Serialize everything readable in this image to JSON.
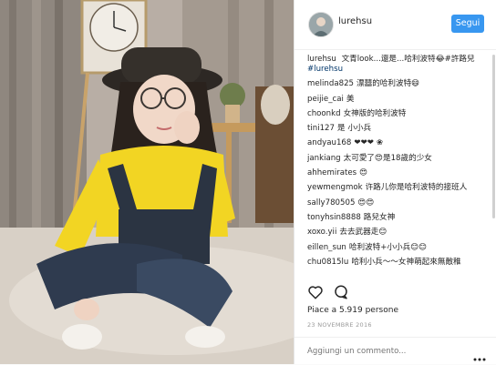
{
  "post": {
    "username": "lurehsu",
    "follow_label": "Segui",
    "likes_text": "Piace a 5.919 persone",
    "date_text": "23 NOVEMBRE 2016",
    "comment_placeholder": "Aggiungi un commento..."
  },
  "caption": {
    "user": "lurehsu",
    "text": "文青look...還是...哈利波特😂#許路兒",
    "tag": "#lurehsu"
  },
  "comments": [
    {
      "user": "melinda825",
      "text": "漂囍的哈利波特😄"
    },
    {
      "user": "peijie_cai",
      "text": "美"
    },
    {
      "user": "choonkd",
      "text": "女神版的哈利波特"
    },
    {
      "user": "tini127",
      "text": "是 小小兵"
    },
    {
      "user": "andyau168",
      "text": "❤❤❤ ❀"
    },
    {
      "user": "jankiang",
      "text": "太可愛了😍是18歲的少女"
    },
    {
      "user": "ahhemirates",
      "text": "😍"
    },
    {
      "user": "yewmengmok",
      "text": "许路儿你是哈利波特的接班人"
    },
    {
      "user": "sally780505",
      "text": "😍😍"
    },
    {
      "user": "tonyhsin8888",
      "text": "路兒女神"
    },
    {
      "user": "xoxo.yii",
      "text": "去去武器走😊"
    },
    {
      "user": "eillen_sun",
      "text": "哈利波特+小小兵😊😊"
    },
    {
      "user": "chu0815lu",
      "text": "哈利小兵～～女神萌起來無敵稚"
    }
  ],
  "icons": {
    "heart": "heart-icon",
    "comment": "comment-icon",
    "more": "more-icon",
    "avatar": "avatar"
  },
  "colors": {
    "follow_button": "#3897f0",
    "text": "#262626",
    "hashtag": "#003569",
    "muted": "#999999"
  }
}
